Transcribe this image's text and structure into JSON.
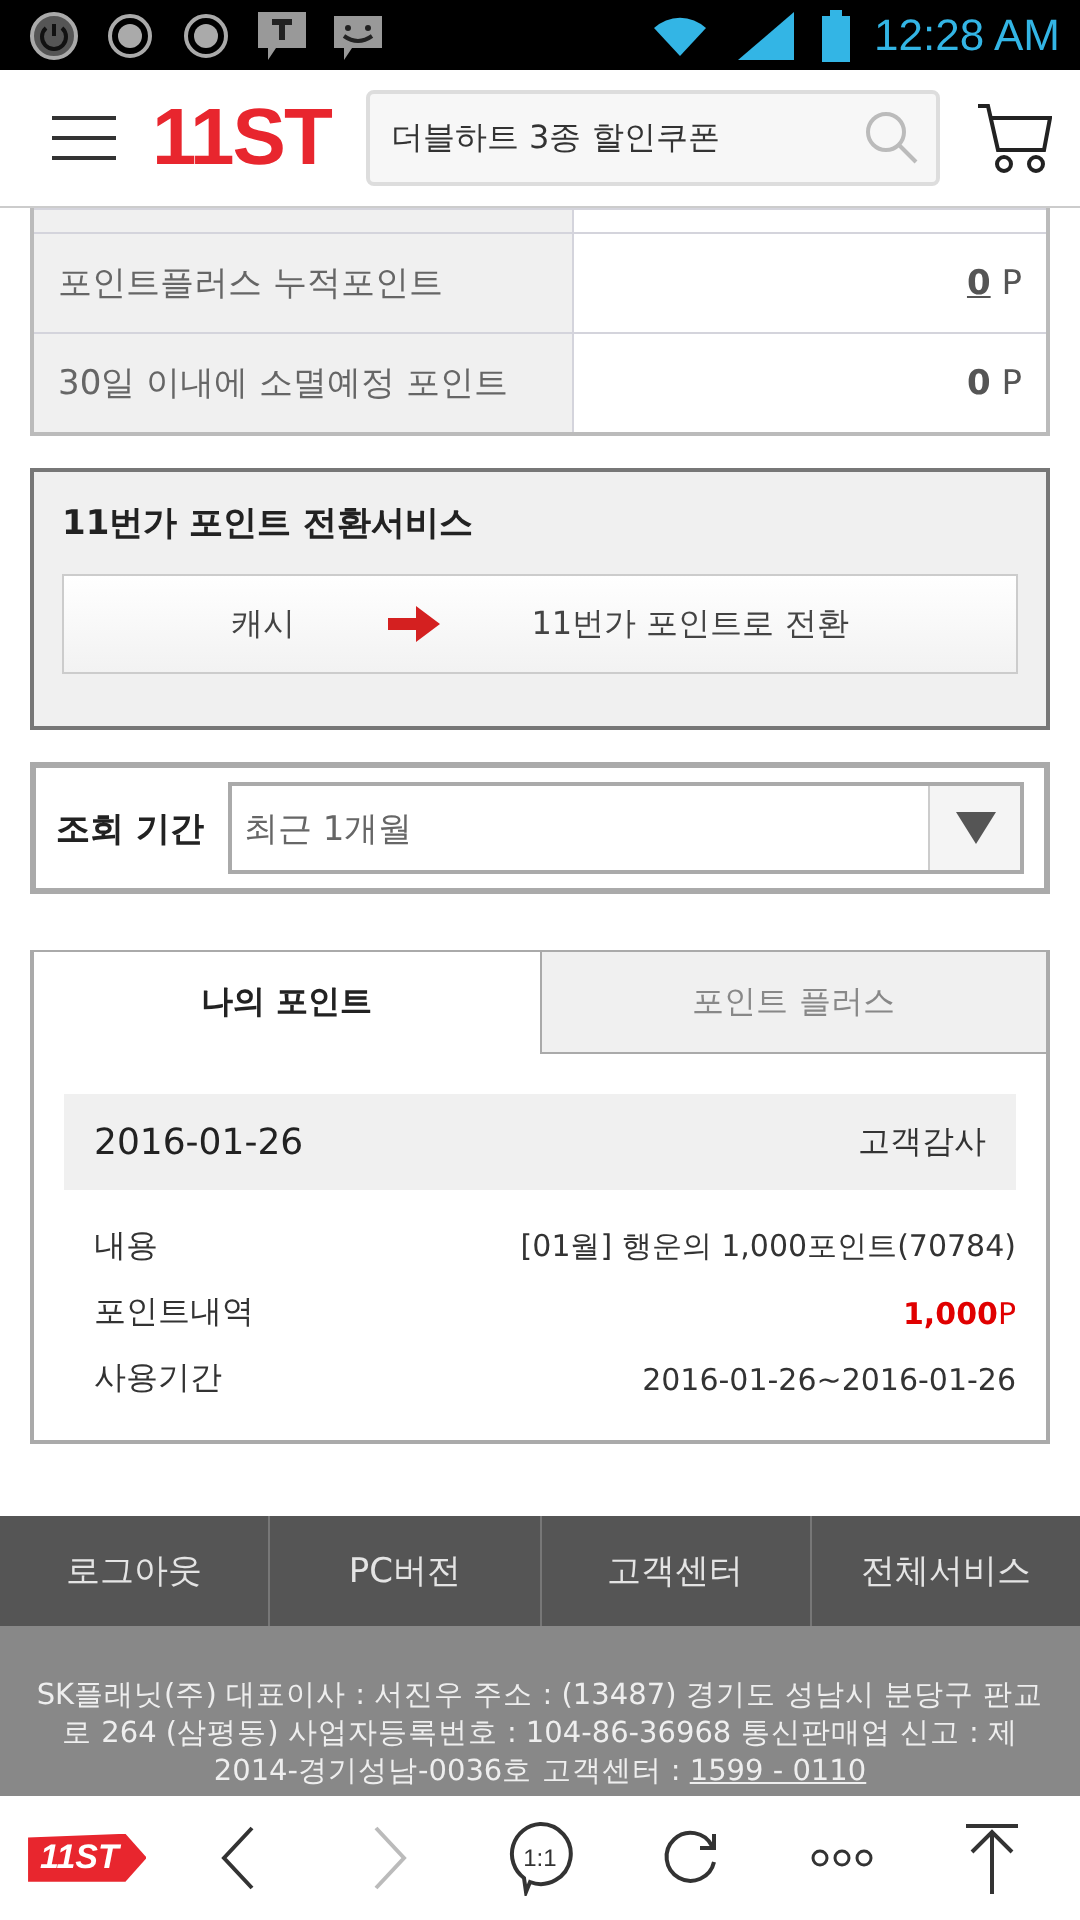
{
  "status_bar": {
    "time": "12:28 AM"
  },
  "header": {
    "logo": "11ST",
    "search": {
      "value": "더블하트 3종 할인쿠폰"
    }
  },
  "summary_rows": [
    {
      "label": "포인트플러스 누적포인트",
      "value": "0",
      "unit": "P",
      "link": true
    },
    {
      "label": "30일 이내에 소멸예정 포인트",
      "value": "0",
      "unit": "P",
      "link": false
    }
  ],
  "conversion": {
    "title": "11번가 포인트 전환서비스",
    "from": "캐시",
    "to": "11번가 포인트로 전환"
  },
  "period": {
    "label": "조회 기간",
    "value": "최근 1개월"
  },
  "tabs": [
    {
      "label": "나의 포인트",
      "selected": true
    },
    {
      "label": "포인트 플러스",
      "selected": false
    }
  ],
  "entry": {
    "date": "2016-01-26",
    "category": "고객감사",
    "rows": [
      {
        "label": "내용",
        "value": "[01월] 행운의 1,000포인트(70784)",
        "highlight": false
      },
      {
        "label": "포인트내역",
        "value": "1,000",
        "unit": "P",
        "highlight": true
      },
      {
        "label": "사용기간",
        "value": "2016-01-26~2016-01-26",
        "highlight": false
      }
    ]
  },
  "footer_nav": [
    "로그아웃",
    "PC버전",
    "고객센터",
    "전체서비스"
  ],
  "company_info": {
    "text": "SK플래닛(주)  대표이사 : 서진우  주소 : (13487) 경기도 성남시 분당구 판교로 264 (삼평동)  사업자등록번호 : 104-86-36968  통신판매업 신고 : 제2014-경기성남-0036호  고객센터 :",
    "phone": "1599 - 0110"
  },
  "toolbar": [
    {
      "kind": "home",
      "text": "11ST"
    },
    {
      "kind": "back"
    },
    {
      "kind": "forward",
      "disabled": true
    },
    {
      "kind": "zoom",
      "text": "1:1"
    },
    {
      "kind": "reload"
    },
    {
      "kind": "more"
    },
    {
      "kind": "top"
    }
  ]
}
